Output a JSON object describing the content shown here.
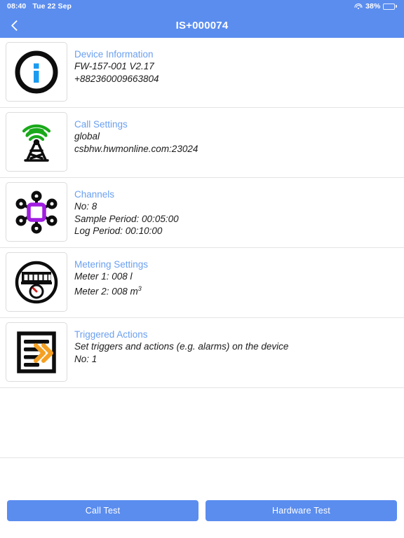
{
  "status_bar": {
    "time": "08:40",
    "date": "Tue 22 Sep",
    "wifi_icon": "wifi-icon",
    "battery_percent": "38%",
    "battery_icon": "battery-icon",
    "battery_level": 38
  },
  "nav": {
    "back_icon": "chevron-left-icon",
    "title": "IS+000074"
  },
  "rows": [
    {
      "icon": "info-circle-icon",
      "title": "Device Information",
      "lines": [
        "FW-157-001 V2.17",
        "+882360009663804"
      ]
    },
    {
      "icon": "cell-tower-icon",
      "title": "Call Settings",
      "lines": [
        "global",
        "csbhw.hwmonline.com:23024"
      ]
    },
    {
      "icon": "network-hub-icon",
      "title": "Channels",
      "lines": [
        "No: 8",
        "Sample Period: 00:05:00",
        "Log Period: 00:10:00"
      ]
    },
    {
      "icon": "water-meter-icon",
      "title": "Metering Settings",
      "lines": [
        "Meter 1: 008 l",
        "Meter 2: 008 m",
        "3"
      ]
    },
    {
      "icon": "document-arrows-icon",
      "title": "Triggered Actions",
      "lines": [
        "Set triggers and actions (e.g. alarms) on the device",
        "No: 1"
      ]
    }
  ],
  "footer": {
    "call_test_label": "Call Test",
    "hardware_test_label": "Hardware Test"
  },
  "colors": {
    "accent_blue": "#5b8def",
    "title_blue": "#6a9ff0",
    "signal_green": "#1aa91a",
    "hub_purple": "#a01ee0",
    "arrow_orange": "#f5a023",
    "needle_red": "#d0211c"
  }
}
